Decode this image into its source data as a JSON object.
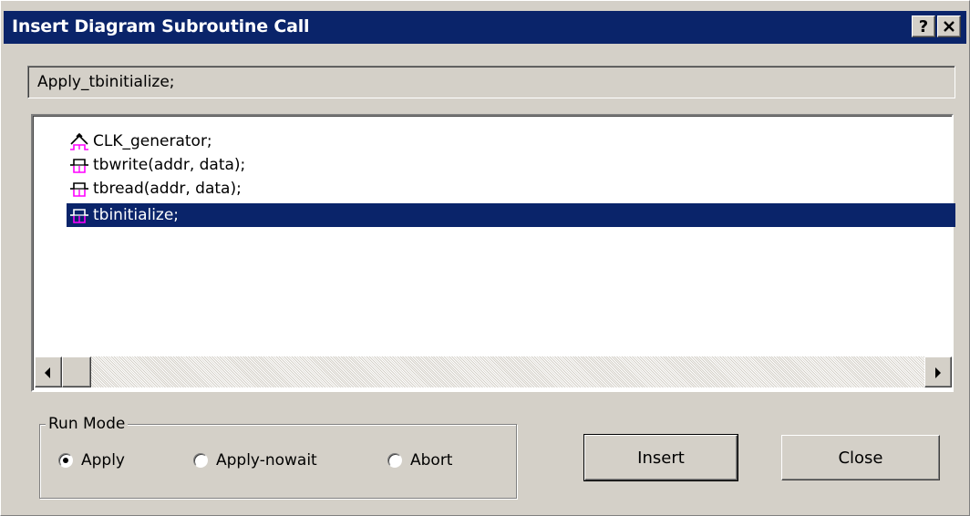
{
  "window": {
    "title": "Insert Diagram Subroutine Call"
  },
  "titlebar_buttons": {
    "help_label": "?",
    "close_label": "✕"
  },
  "status": {
    "text": "Apply_tbinitialize;"
  },
  "list": {
    "items": [
      {
        "label": "CLK_generator;",
        "icon": "clock-subroutine-icon",
        "selected": false
      },
      {
        "label": "tbwrite(addr, data);",
        "icon": "subroutine-icon",
        "selected": false
      },
      {
        "label": "tbread(addr, data);",
        "icon": "subroutine-icon",
        "selected": false
      },
      {
        "label": "tbinitialize;",
        "icon": "subroutine-icon",
        "selected": true
      }
    ]
  },
  "run_mode": {
    "legend": "Run Mode",
    "options": [
      {
        "label": "Apply",
        "selected": true
      },
      {
        "label": "Apply-nowait",
        "selected": false
      },
      {
        "label": "Abort",
        "selected": false
      }
    ]
  },
  "buttons": {
    "insert": "Insert",
    "close": "Close"
  },
  "colors": {
    "titlebar": "#0a246a",
    "selection": "#0a246a",
    "icon_magenta": "#ff00ff",
    "face": "#d4d0c8"
  }
}
